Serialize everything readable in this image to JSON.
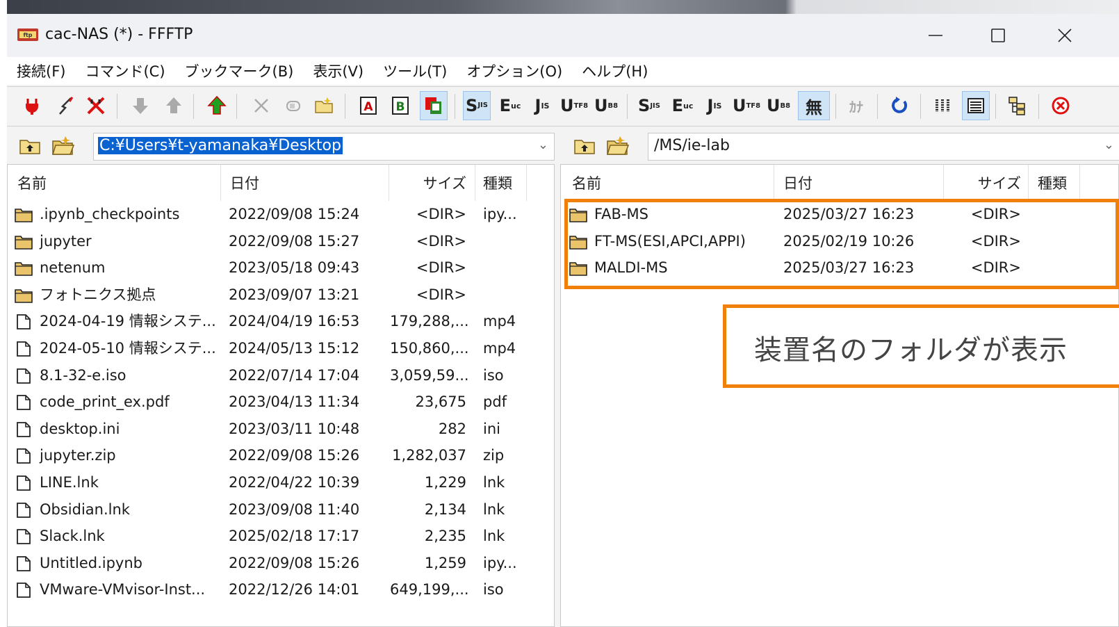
{
  "window": {
    "title": "cac-NAS (*) - FFFTP",
    "controls": [
      "minimize-icon",
      "maximize-icon",
      "close-icon"
    ]
  },
  "menu": [
    "接続(F)",
    "コマンド(C)",
    "ブックマーク(B)",
    "表示(V)",
    "ツール(T)",
    "オプション(O)",
    "ヘルプ(H)"
  ],
  "toolbar": {
    "icons": [
      "connect-icon",
      "quick-connect-icon",
      "disconnect-icon",
      "download-icon",
      "upload-icon",
      "mirror-upload-icon",
      "delete-icon",
      "rename-icon",
      "mkdir-icon",
      "ascii-mode-icon",
      "binary-mode-icon",
      "auto-mode-icon",
      "local-sjis-icon",
      "local-euc-icon",
      "local-jis-icon",
      "local-utf8-icon",
      "local-utf8bom-icon",
      "host-sjis-icon",
      "host-euc-icon",
      "host-jis-icon",
      "host-utf8-icon",
      "host-utf8bom-icon",
      "no-conversion-icon",
      "kana-conversion-icon",
      "refresh-icon",
      "list-view-icon",
      "detail-view-icon",
      "sync-dir-icon",
      "abort-icon"
    ],
    "labels": {
      "ascii": "A",
      "binary": "B",
      "auto": "🗎",
      "l_sjis": "S",
      "l_euc": "E",
      "l_jis": "J",
      "l_utf8": "U",
      "l_utf8bom": "U",
      "h_sjis": "S",
      "h_euc": "E",
      "h_jis": "J",
      "h_utf8": "U",
      "h_utf8bom": "U",
      "no_conv": "無",
      "kana": "ｶﾅ"
    }
  },
  "local": {
    "path": "C:¥Users¥t-yamanaka¥Desktop",
    "columns": {
      "name": "名前",
      "date": "日付",
      "size": "サイズ",
      "type": "種類"
    },
    "files": [
      {
        "name": ".ipynb_checkpoints",
        "date": "2022/09/08 15:24",
        "size": "<DIR>",
        "type": "ipy...",
        "kind": "folder"
      },
      {
        "name": "jupyter",
        "date": "2022/09/08 15:27",
        "size": "<DIR>",
        "type": "",
        "kind": "folder"
      },
      {
        "name": "netenum",
        "date": "2023/05/18 09:43",
        "size": "<DIR>",
        "type": "",
        "kind": "folder"
      },
      {
        "name": "フォトニクス拠点",
        "date": "2023/09/07 13:21",
        "size": "<DIR>",
        "type": "",
        "kind": "folder"
      },
      {
        "name": "2024-04-19 情報システ...",
        "date": "2024/04/19 16:53",
        "size": "179,288,...",
        "type": "mp4",
        "kind": "file"
      },
      {
        "name": "2024-05-10 情報システ...",
        "date": "2024/05/13 15:12",
        "size": "150,860,...",
        "type": "mp4",
        "kind": "file"
      },
      {
        "name": "8.1-32-e.iso",
        "date": "2022/07/14 17:04",
        "size": "3,059,59...",
        "type": "iso",
        "kind": "file"
      },
      {
        "name": "code_print_ex.pdf",
        "date": "2023/04/13 11:34",
        "size": "23,675",
        "type": "pdf",
        "kind": "file"
      },
      {
        "name": "desktop.ini",
        "date": "2023/03/11 10:48",
        "size": "282",
        "type": "ini",
        "kind": "file"
      },
      {
        "name": "jupyter.zip",
        "date": "2022/09/08 15:26",
        "size": "1,282,037",
        "type": "zip",
        "kind": "file"
      },
      {
        "name": "LINE.lnk",
        "date": "2022/04/22 10:39",
        "size": "1,229",
        "type": "lnk",
        "kind": "file"
      },
      {
        "name": "Obsidian.lnk",
        "date": "2023/09/08 11:40",
        "size": "2,134",
        "type": "lnk",
        "kind": "file"
      },
      {
        "name": "Slack.lnk",
        "date": "2025/02/18 17:17",
        "size": "2,235",
        "type": "lnk",
        "kind": "file"
      },
      {
        "name": "Untitled.ipynb",
        "date": "2022/09/08 15:26",
        "size": "1,259",
        "type": "ipy...",
        "kind": "file"
      },
      {
        "name": "VMware-VMvisor-Inst...",
        "date": "2022/12/26 14:01",
        "size": "649,199,...",
        "type": "iso",
        "kind": "file"
      }
    ]
  },
  "remote": {
    "path": "/MS/ie-lab",
    "columns": {
      "name": "名前",
      "date": "日付",
      "size": "サイズ",
      "type": "種類"
    },
    "files": [
      {
        "name": "FAB-MS",
        "date": "2025/03/27 16:23",
        "size": "<DIR>",
        "type": "",
        "kind": "folder"
      },
      {
        "name": "FT-MS(ESI,APCI,APPI)",
        "date": "2025/02/19 10:26",
        "size": "<DIR>",
        "type": "",
        "kind": "folder"
      },
      {
        "name": "MALDI-MS",
        "date": "2025/03/27 16:23",
        "size": "<DIR>",
        "type": "",
        "kind": "folder"
      }
    ]
  },
  "annotation": {
    "text": "装置名のフォルダが表示",
    "color": "#f0800a"
  },
  "colors": {
    "selection": "#0a62d0",
    "folder": "#e9c46a",
    "highlight": "#f0800a"
  }
}
